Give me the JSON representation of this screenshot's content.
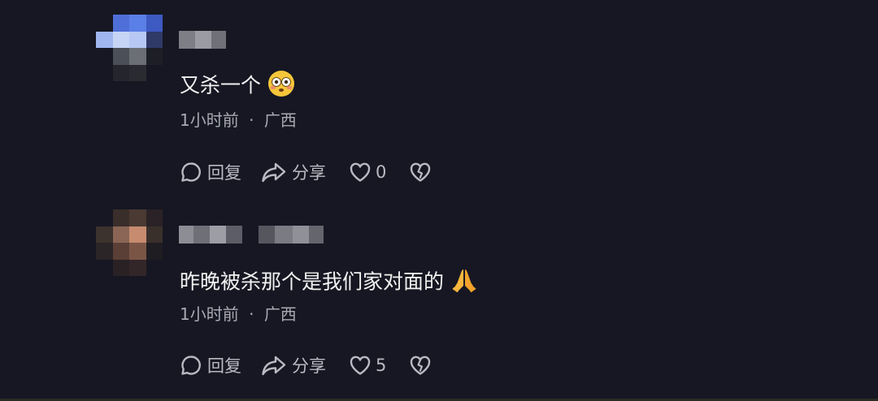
{
  "comments": [
    {
      "text": "又杀一个",
      "emoji": "flushed-face-emoji",
      "time": "1小时前",
      "separator": "·",
      "location": "广西",
      "reply_label": "回复",
      "share_label": "分享",
      "like_count": "0"
    },
    {
      "text": "昨晚被杀那个是我们家对面的",
      "emoji": "folded-hands-emoji",
      "time": "1小时前",
      "separator": "·",
      "location": "广西",
      "reply_label": "回复",
      "share_label": "分享",
      "like_count": "5"
    }
  ],
  "colors": {
    "background": "#161722",
    "text": "#f2f2f2",
    "meta": "#a8a9b3",
    "action": "#b9bac2"
  }
}
